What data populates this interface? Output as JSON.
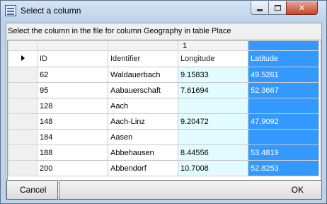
{
  "window": {
    "title": "Select a column",
    "icon": "table-icon",
    "controls": {
      "minimize": "minimize-icon",
      "maximize": "maximize-icon",
      "close": "✕"
    }
  },
  "instruction": "Select the column in the file for column Geography in table Place",
  "grid": {
    "selected_column_number": "1",
    "headers": [
      "ID",
      "Identifier",
      "Longitude",
      "Latitude"
    ],
    "rows": [
      [
        "62",
        "Waldauerbach",
        "9.15833",
        "49.5261"
      ],
      [
        "95",
        "Aabauerschaft",
        "7.61694",
        "52.3667"
      ],
      [
        "128",
        "Aach",
        "",
        ""
      ],
      [
        "148",
        "Aach-Linz",
        "9.20472",
        "47.9092"
      ],
      [
        "184",
        "Aasen",
        "",
        ""
      ],
      [
        "188",
        "Abbehausen",
        "8.44556",
        "53.4819"
      ],
      [
        "200",
        "Abbendorf",
        "10.7008",
        "52.8253"
      ]
    ],
    "highlight_colors": {
      "selected": "#3399ff",
      "longitude": "#e1fbff"
    }
  },
  "buttons": {
    "cancel": "Cancel",
    "ok": "OK"
  }
}
